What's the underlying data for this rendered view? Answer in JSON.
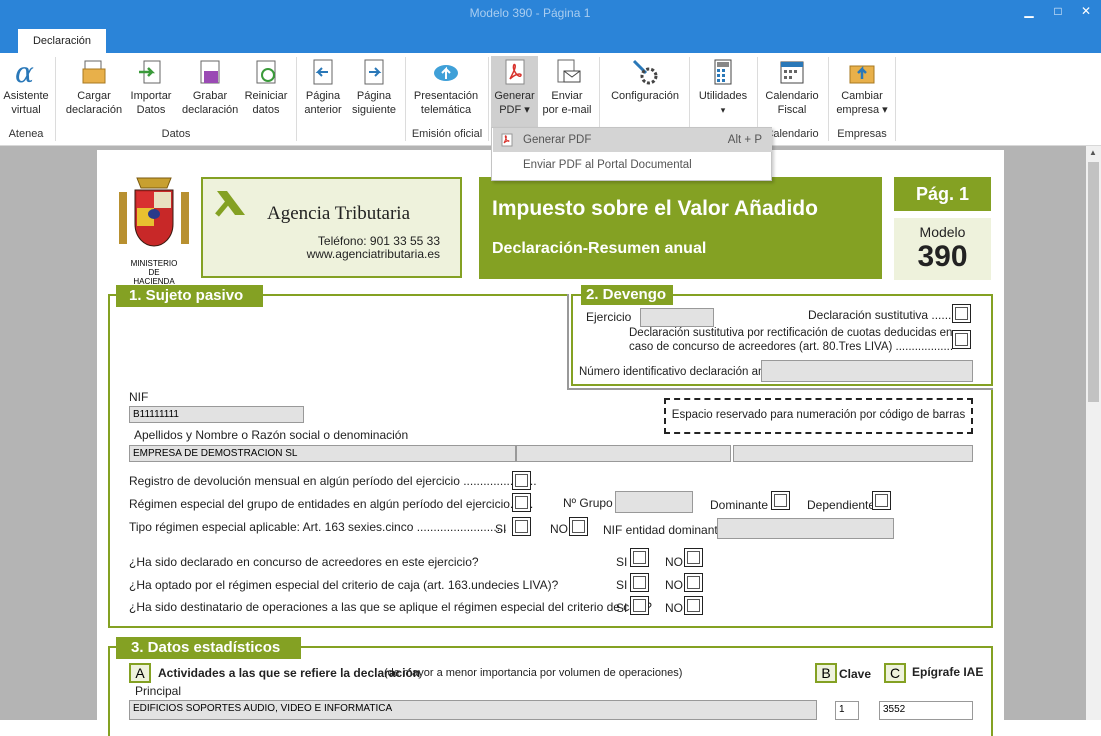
{
  "window": {
    "title": "Modelo 390 - Página 1"
  },
  "ribbon": {
    "tab": "Declaración",
    "buttons": {
      "asistente": [
        "Asistente",
        "virtual"
      ],
      "cargar": [
        "Cargar",
        "declaración"
      ],
      "importar": [
        "Importar",
        "Datos"
      ],
      "grabar": [
        "Grabar",
        "declaración"
      ],
      "reiniciar": [
        "Reiniciar",
        "datos"
      ],
      "anterior": [
        "Página",
        "anterior"
      ],
      "siguiente": [
        "Página",
        "siguiente"
      ],
      "presentacion": [
        "Presentación",
        "telemática"
      ],
      "generar": [
        "Generar",
        "PDF ▾"
      ],
      "enviar": [
        "Enviar",
        "por e-mail"
      ],
      "config": [
        "Configuración",
        ""
      ],
      "utilidades": [
        "Utilidades",
        ""
      ],
      "calendario": [
        "Calendario",
        "Fiscal"
      ],
      "cambiar": [
        "Cambiar",
        "empresa ▾"
      ]
    },
    "groups": {
      "atenea": "Atenea",
      "datos": "Datos",
      "emision": "Emisión oficial",
      "calendario": "Calendario",
      "empresas": "Empresas"
    }
  },
  "menu": {
    "item1": "Generar PDF",
    "item1_shortcut": "Alt + P",
    "item2": "Enviar PDF al Portal Documental"
  },
  "form": {
    "ministerio": "MINISTERIO DE HACIENDA",
    "agencia": "Agencia Tributaria",
    "telefono": "Teléfono: 901 33 55 33",
    "web": "www.agenciatributaria.es",
    "impuesto": "Impuesto sobre el Valor Añadido",
    "declaracion": "Declaración-Resumen anual",
    "pag": "Pág. 1",
    "modelo_label": "Modelo",
    "modelo": "390",
    "sec1": "1. Sujeto pasivo",
    "sec2": "2. Devengo",
    "ejercicio": "Ejercicio",
    "sustitutiva": "Declaración sustitutiva .......",
    "sustitutiva_rect1": "Declaración sustitutiva por rectificación de cuotas deducidas en",
    "sustitutiva_rect2": "caso de concurso de acreedores (art. 80.Tres LIVA) ..................",
    "num_anterior": "Número identificativo declaración anterior",
    "nif_label": "NIF",
    "nif": "B11111111",
    "barras": "Espacio reservado para numeración por código de barras",
    "nombre_label": "Apellidos y Nombre o Razón social o denominación",
    "nombre": "EMPRESA DE DEMOSTRACION SL",
    "reg_dev": "Registro de devolución mensual en algún período del ejercicio ......................",
    "reg_esp": "Régimen especial del grupo de entidades en algún período del ejercicio.......",
    "n_grupo": "Nº Grupo",
    "dominante": "Dominante",
    "dependiente": "Dependiente",
    "tipo_reg": "Tipo régimen especial aplicable: Art. 163 sexies.cinco ...........................",
    "si": "SI",
    "no": "NO",
    "nif_dom": "NIF entidad dominante",
    "q1": "¿Ha sido declarado en concurso de acreedores en este ejercicio?",
    "q2": "¿Ha optado por el régimen especial del criterio de caja (art. 163.undecies LIVA)?",
    "q3": "¿Ha sido destinatario de operaciones a las que se aplique el régimen especial del criterio de caja?",
    "sec3": "3. Datos estadísticos",
    "a": "A",
    "actividades": "Actividades a las que se refiere la declaración",
    "actividades_sub": "(de mayor a menor importancia por volumen de operaciones)",
    "b": "B",
    "clave": "Clave",
    "c": "C",
    "epigrafe": "Epígrafe IAE",
    "principal": "Principal",
    "actividad": "EDIFICIOS SOPORTES AUDIO, VIDEO E INFORMATICA",
    "clave_val": "1",
    "epigrafe_val": "3552"
  },
  "colors": {
    "accent": "#84a123",
    "titlebar": "#2b84d8"
  }
}
